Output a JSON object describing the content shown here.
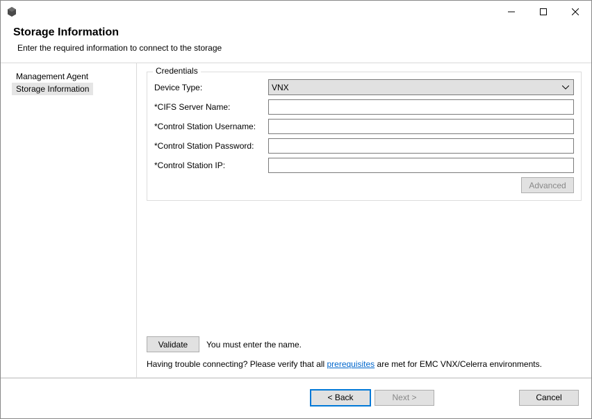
{
  "header": {
    "title": "Storage Information",
    "subtitle": "Enter the required information to connect to the storage"
  },
  "sidebar": {
    "items": [
      {
        "label": "Management Agent",
        "selected": false
      },
      {
        "label": "Storage Information",
        "selected": true
      }
    ]
  },
  "credentials": {
    "legend": "Credentials",
    "device_type_label": "Device Type:",
    "device_type_value": "VNX",
    "cifs_label": "*CIFS Server Name:",
    "cifs_value": "",
    "cs_user_label": "*Control Station Username:",
    "cs_user_value": "",
    "cs_pass_label": "*Control Station Password:",
    "cs_pass_value": "",
    "cs_ip_label": "*Control Station IP:",
    "cs_ip_value": "",
    "advanced_label": "Advanced"
  },
  "validate": {
    "button": "Validate",
    "message": "You must enter the name."
  },
  "trouble": {
    "prefix": "Having trouble connecting? Please verify that all ",
    "link": "prerequisites",
    "suffix": " are met for EMC VNX/Celerra environments."
  },
  "footer": {
    "back": "< Back",
    "next": "Next >",
    "cancel": "Cancel"
  }
}
